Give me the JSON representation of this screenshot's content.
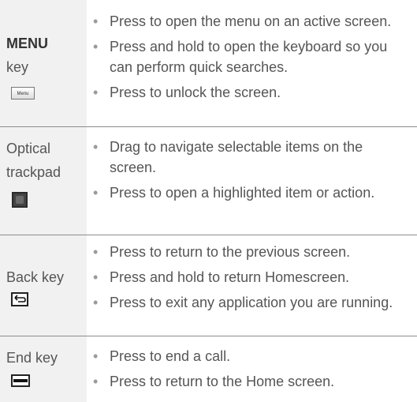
{
  "rows": [
    {
      "key_bold": "MENU",
      "key_rest": "key",
      "icon": "menu-key-icon",
      "icon_text": "Menu",
      "bullets": [
        "Press to open the menu on an active screen.",
        "Press and hold to open the keyboard so you can perform quick searches.",
        "Press to unlock the screen."
      ]
    },
    {
      "key_line1": "Optical",
      "key_line2": "trackpad",
      "icon": "trackpad-icon",
      "bullets": [
        "Drag to navigate selectable items on the screen.",
        "Press to open a highlighted item or action."
      ]
    },
    {
      "key_line1": "Back key",
      "icon": "back-key-icon",
      "bullets": [
        "Press to return to the previous screen.",
        "Press and hold to return Homescreen.",
        "Press to exit any application you are running."
      ]
    },
    {
      "key_line1": "End key",
      "icon": "end-key-icon",
      "bullets": [
        "Press to end a call.",
        "Press to return to the Home screen."
      ]
    }
  ],
  "colors": {
    "key_column_bg": "#f1f1f1",
    "separator": "#8c8c8c",
    "text": "#555555"
  }
}
